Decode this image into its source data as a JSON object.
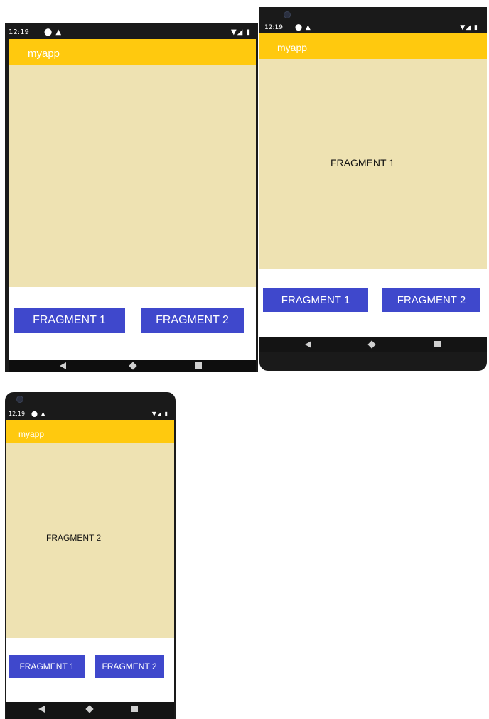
{
  "screens": [
    {
      "status_time": "12:19",
      "status_icons_left": "⬤ ▲",
      "status_icons_right": "▼◢ ▮",
      "app_title": "myapp",
      "fragment_label": "",
      "button1": "FRAGMENT 1",
      "button2": "FRAGMENT 2"
    },
    {
      "status_time": "12:19",
      "status_icons_left": "⬤ ▲",
      "status_icons_right": "▼◢ ▮",
      "app_title": "myapp",
      "fragment_label": "FRAGMENT 1",
      "button1": "FRAGMENT 1",
      "button2": "FRAGMENT 2"
    },
    {
      "status_time": "12:19",
      "status_icons_left": "⬤ ▲",
      "status_icons_right": "▼◢ ▮",
      "app_title": "myapp",
      "fragment_label": "FRAGMENT 2",
      "button1": "FRAGMENT 1",
      "button2": "FRAGMENT 2"
    }
  ],
  "colors": {
    "app_bar": "#ffc90e",
    "content_bg": "#eee2b2",
    "button": "#3f48cc"
  }
}
